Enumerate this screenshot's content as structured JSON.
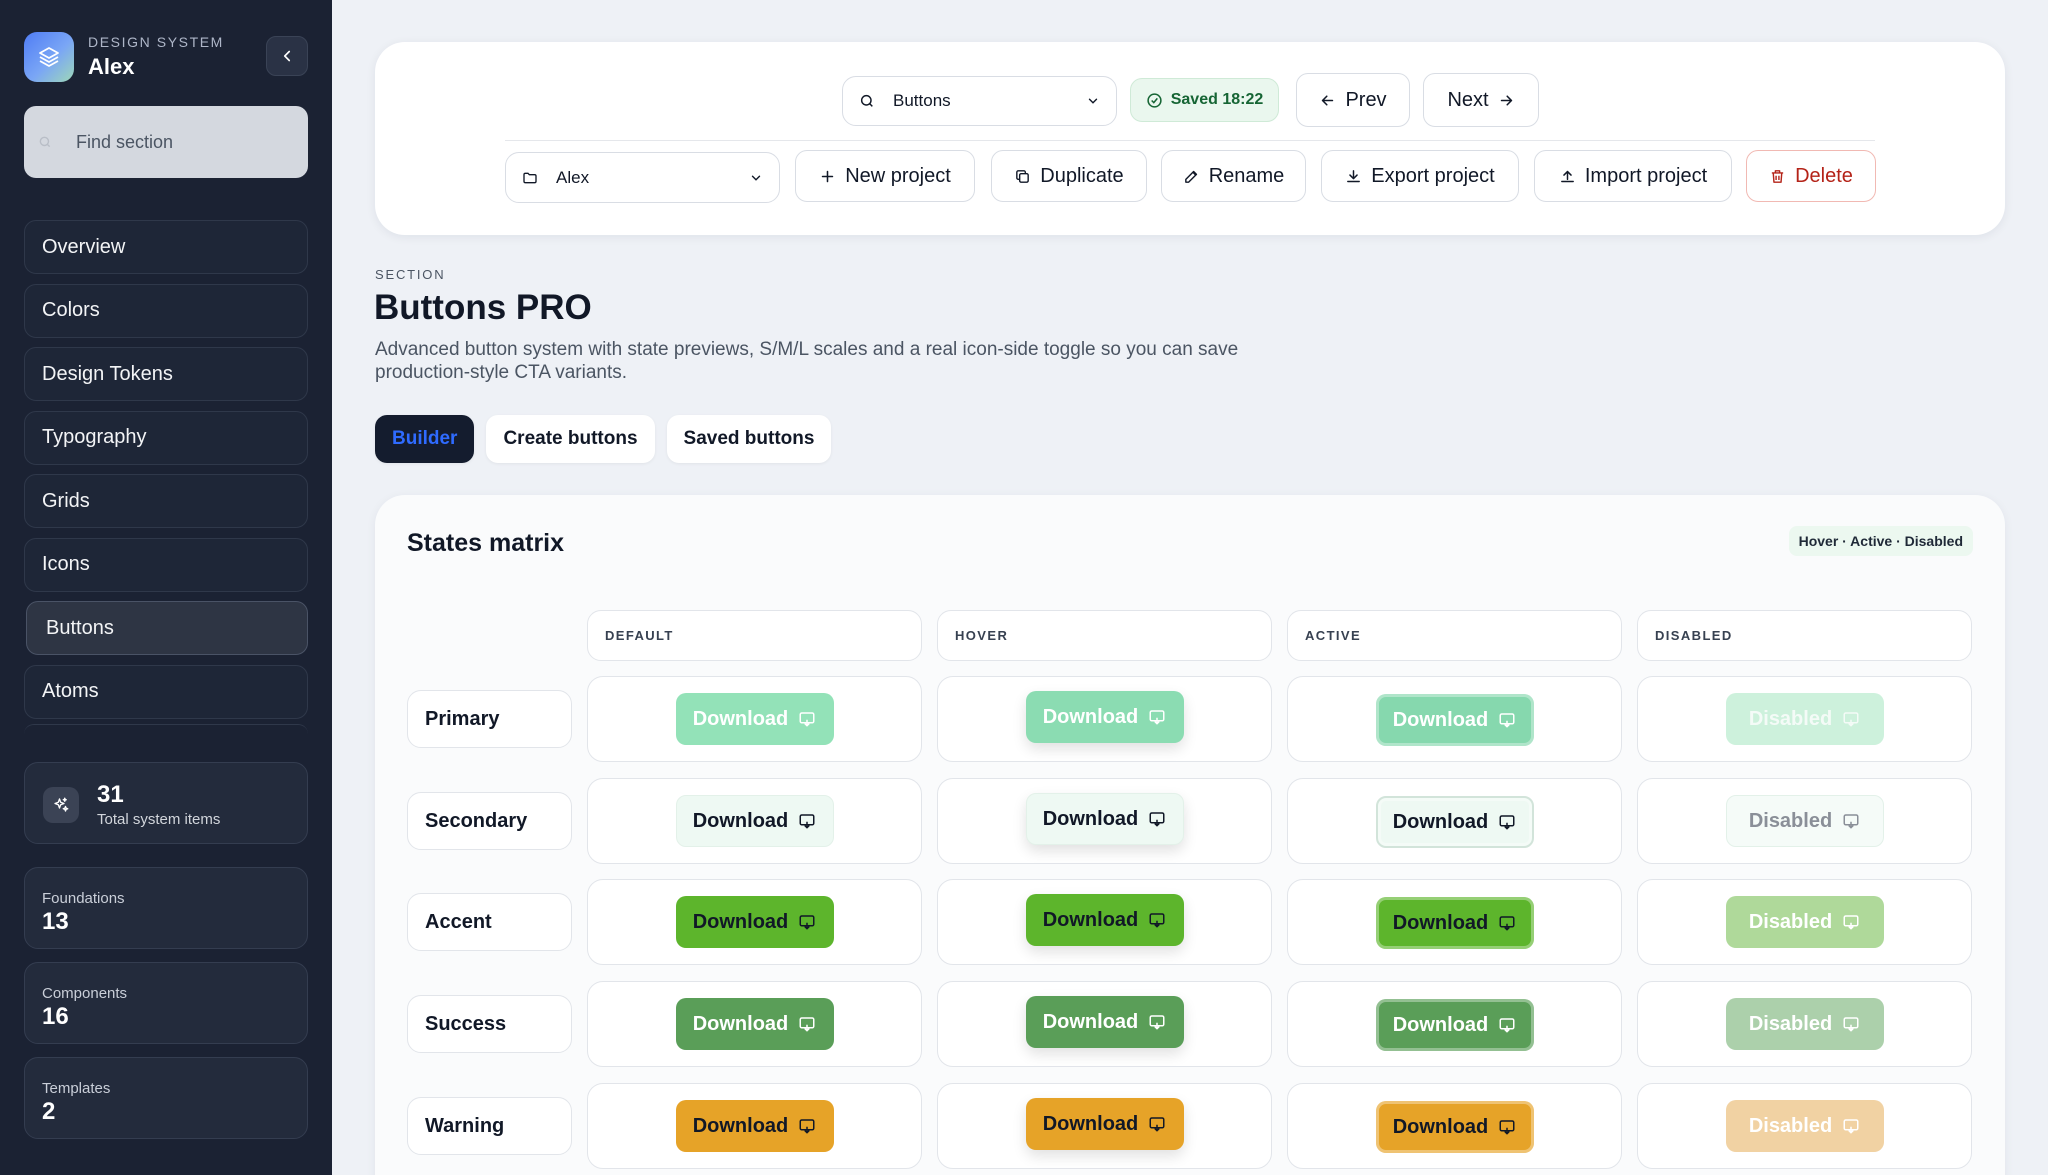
{
  "sidebar": {
    "kicker": "DESIGN SYSTEM",
    "name": "Alex",
    "search_placeholder": "Find section",
    "nav": [
      "Overview",
      "Colors",
      "Design Tokens",
      "Typography",
      "Grids",
      "Icons",
      "Buttons",
      "Atoms"
    ],
    "active_nav": "Buttons",
    "total": {
      "value": "31",
      "label": "Total system items"
    },
    "stats": [
      {
        "label": "Foundations",
        "value": "13"
      },
      {
        "label": "Components",
        "value": "16"
      },
      {
        "label": "Templates",
        "value": "2"
      }
    ]
  },
  "toolbar": {
    "section_select": "Buttons",
    "saved": "Saved 18:22",
    "prev": "Prev",
    "next": "Next",
    "project_select": "Alex",
    "new_project": "New project",
    "duplicate": "Duplicate",
    "rename": "Rename",
    "export": "Export project",
    "import": "Import project",
    "delete": "Delete"
  },
  "section": {
    "kicker": "SECTION",
    "title": "Buttons PRO",
    "description": "Advanced button system with state previews, S/M/L scales and a real icon-side toggle so you can save production-style CTA variants."
  },
  "tabs": [
    "Builder",
    "Create buttons",
    "Saved buttons"
  ],
  "active_tab": "Builder",
  "matrix": {
    "title": "States matrix",
    "badge": "Hover · Active · Disabled",
    "columns": [
      "DEFAULT",
      "HOVER",
      "ACTIVE",
      "DISABLED"
    ],
    "rows": [
      "Primary",
      "Secondary",
      "Accent",
      "Success",
      "Warning"
    ],
    "button_label": "Download",
    "disabled_label": "Disabled"
  },
  "colors": {
    "sidebar_bg": "#1b2233",
    "primary": "#93e2b8",
    "secondary": "#eef9f3",
    "accent": "#5db52c",
    "success": "#5a9e58",
    "warning": "#e6a328",
    "delete": "#b42318"
  },
  "icons": {
    "brand": "layers-icon",
    "download_button": "monitor-download-icon"
  }
}
